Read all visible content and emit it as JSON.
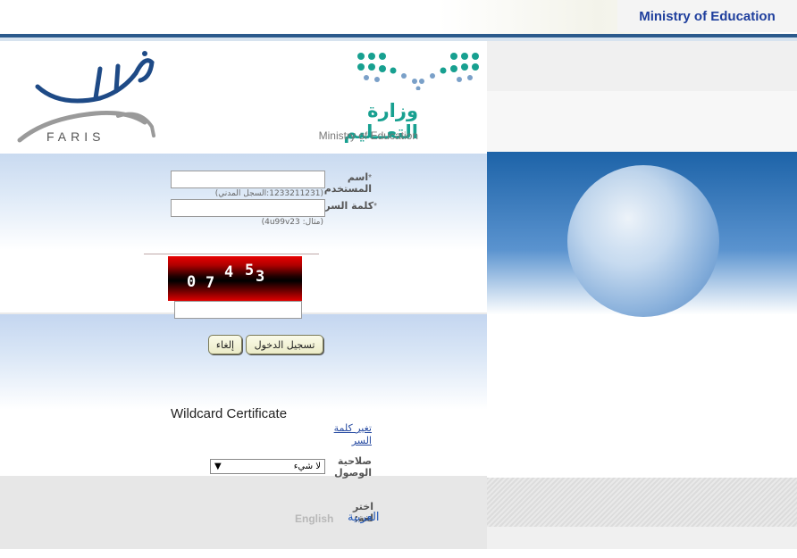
{
  "header": {
    "ministry_title": "Ministry of Education"
  },
  "logos": {
    "faris_latin": "FARIS",
    "faris_arabic": "فارس",
    "moe_arabic": "وزارة التعــليم",
    "moe_english": "Ministry of Education"
  },
  "login": {
    "required_mark": "*",
    "username_label": "اسم المستخدم",
    "username_value": "",
    "username_hint": "(1233211231:السجل المدني)",
    "password_label": "كلمة السر",
    "password_value": "",
    "password_hint": "(مثال: 4u99v23)",
    "captcha_digits": [
      "0",
      "7",
      "4",
      "5",
      "3"
    ],
    "captcha_value": ""
  },
  "actions": {
    "login_label": "تسجيل الدخول",
    "cancel_label": "إلغاء"
  },
  "misc": {
    "wildcard_text": "Wildcard Certificate",
    "change_password": "تغير كلمة السر",
    "access_label": "صلاحية الوصول",
    "access_selected": "لا شيء",
    "access_arrow": "▼"
  },
  "language": {
    "choose_label": "اختر لغة:",
    "arabic": "العربية",
    "english": "English"
  },
  "colors": {
    "header_blue": "#1f3f9d",
    "moe_teal": "#17a090",
    "link_blue": "#2448a0",
    "rule_blue": "#2b5a8c"
  }
}
